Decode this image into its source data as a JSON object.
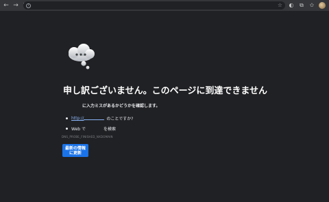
{
  "toolbar": {
    "back_icon": "back-arrow-icon",
    "forward_icon": "forward-arrow-icon",
    "reload_icon": "reload-icon",
    "info_icon": "info-icon",
    "star_icon": "star-icon",
    "menu_icon": "more-icon"
  },
  "error": {
    "title": "申し訳ございません。このページに到達できません",
    "suggestions_heading": "に入力ミスがあるかどうかを確認します。",
    "suggestion_url_prefix": "http://",
    "suggestion_url_suffix": "のことですか?",
    "suggestion_web_prefix": "Web で",
    "suggestion_web_suffix": "を検索",
    "code": "DNS_PROBE_FINISHED_NXDOMAIN",
    "reload_label": "最新の情報\nに更新"
  },
  "colors": {
    "background": "#202124",
    "accent": "#1a73e8",
    "link": "#8ab4f8"
  }
}
